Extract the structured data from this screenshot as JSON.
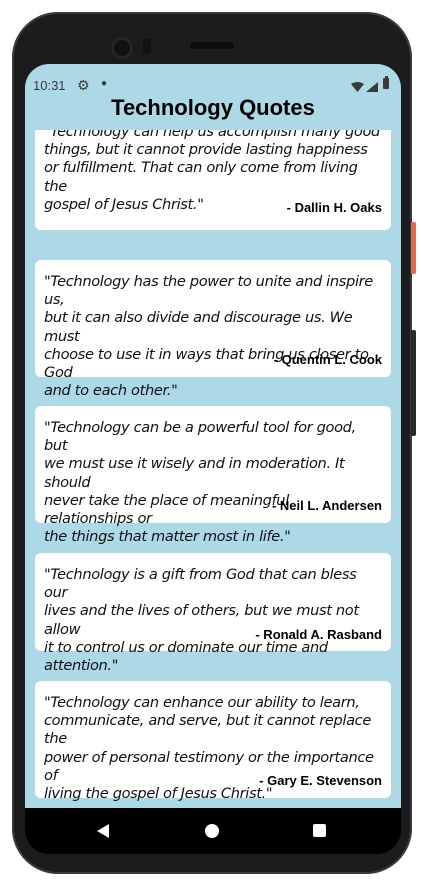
{
  "status_bar": {
    "time": "10:31",
    "icons": [
      "gear-icon",
      "notification-dot-icon",
      "wifi-icon",
      "signal-icon",
      "battery-icon"
    ]
  },
  "app": {
    "title": "Technology Quotes",
    "background_color": "#add8e6",
    "card_color": "#ffffff"
  },
  "quotes": [
    {
      "lines": [
        "\"Technology can help us accomplish many good",
        "things, but it cannot provide lasting happiness",
        "or fulfillment. That can only come from living the",
        "gospel of Jesus Christ.\""
      ],
      "author": "- Dallin H. Oaks"
    },
    {
      "lines": [
        "\"Technology has the power to unite and inspire us,",
        "but it can also divide and discourage us. We must",
        "choose to use it in ways that bring us closer to God",
        "and to each other.\""
      ],
      "author": "- Quentin L. Cook"
    },
    {
      "lines": [
        "\"Technology can be a powerful tool for good, but",
        "we must use it wisely and in moderation. It should",
        "never take the place of meaningful relationships or",
        "the things that matter most in life.\""
      ],
      "author": "- Neil L. Andersen"
    },
    {
      "lines": [
        "\"Technology is a gift from God that can bless our",
        "lives and the lives of others, but we must not allow",
        "it to control us or dominate our time and attention.\""
      ],
      "author": "- Ronald A. Rasband"
    },
    {
      "lines": [
        "\"Technology can enhance our ability to learn,",
        "communicate, and serve, but it cannot replace the",
        "power of personal testimony or the importance of",
        "living the gospel of Jesus Christ.\""
      ],
      "author": "- Gary E. Stevenson"
    }
  ],
  "nav_bar": {
    "buttons": [
      "back-icon",
      "home-icon",
      "recents-icon"
    ]
  }
}
